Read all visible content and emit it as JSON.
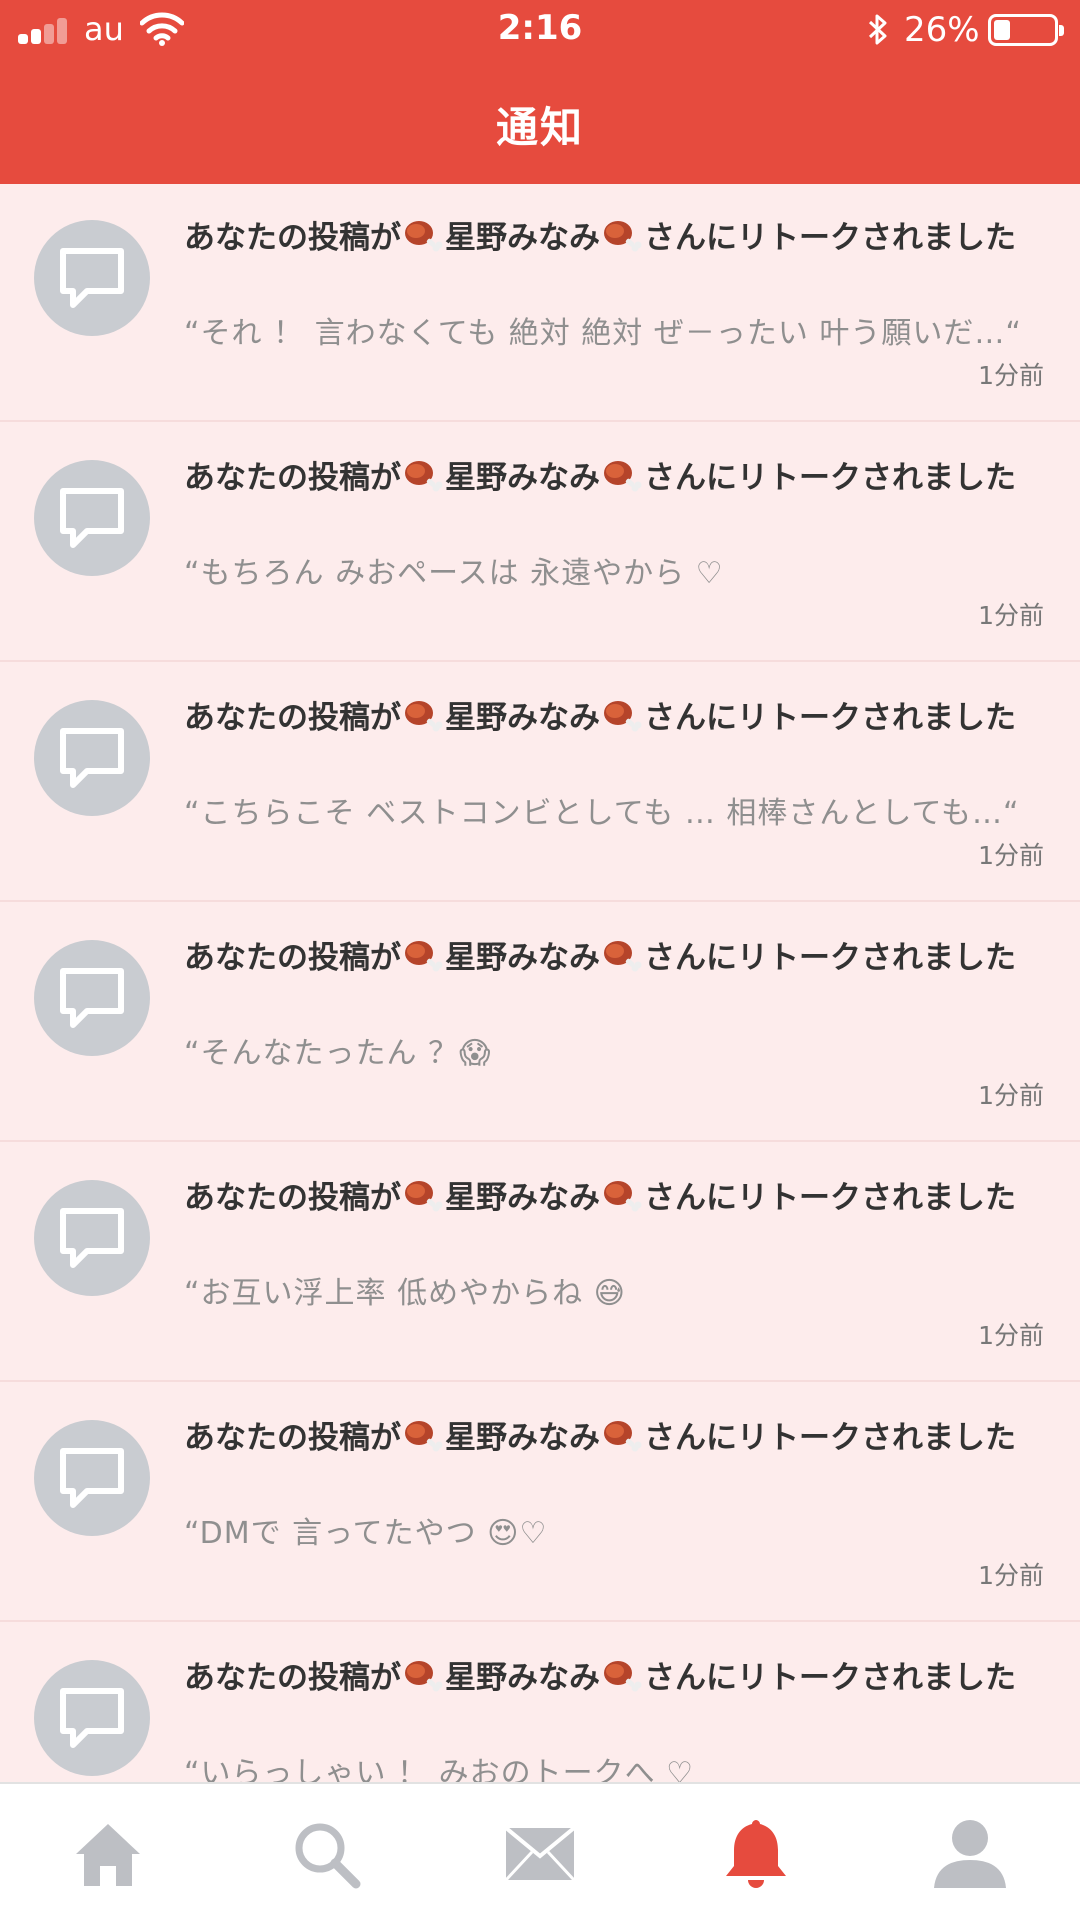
{
  "status_bar": {
    "carrier": "au",
    "time": "2:16",
    "battery": "26%"
  },
  "header": {
    "title": "通知"
  },
  "notifications": [
    {
      "headline_prefix": "あなたの投稿が",
      "headline_name": "星野みなみ",
      "headline_suffix": "さんにリトークされました",
      "icon": "meat-on-bone-icon",
      "preview": "“それ ！ 言わなくても 絶対 絶対 ぜ－ったい 叶う願いだ…“",
      "time": "1分前"
    },
    {
      "headline_prefix": "あなたの投稿が",
      "headline_name": "星野みなみ",
      "headline_suffix": "さんにリトークされました",
      "icon": "meat-on-bone-icon",
      "preview": "“もちろん みおペースは 永遠やから ♡",
      "time": "1分前"
    },
    {
      "headline_prefix": "あなたの投稿が",
      "headline_name": "星野みなみ",
      "headline_suffix": "さんにリトークされました",
      "icon": "meat-on-bone-icon",
      "preview": "“こちらこそ ベストコンビとしても … 相棒さんとしても…“",
      "time": "1分前"
    },
    {
      "headline_prefix": "あなたの投稿が",
      "headline_name": "星野みなみ",
      "headline_suffix": "さんにリトークされました",
      "icon": "meat-on-bone-icon",
      "preview": "“そんなたったん ？😱",
      "time": "1分前"
    },
    {
      "headline_prefix": "あなたの投稿が",
      "headline_name": "星野みなみ",
      "headline_suffix": "さんにリトークされました",
      "icon": "meat-on-bone-icon",
      "preview": "“お互い浮上率 低めやからね 😅",
      "time": "1分前"
    },
    {
      "headline_prefix": "あなたの投稿が",
      "headline_name": "星野みなみ",
      "headline_suffix": "さんにリトークされました",
      "icon": "meat-on-bone-icon",
      "preview": "“DMで 言ってたやつ 😍♡",
      "time": "1分前"
    },
    {
      "headline_prefix": "あなたの投稿が",
      "headline_name": "星野みなみ",
      "headline_suffix": "さんにリトークされました",
      "icon": "meat-on-bone-icon",
      "preview": "“いらっしゃい ！ みおのトークへ ♡",
      "time": ""
    }
  ],
  "tabs": [
    {
      "name": "home",
      "icon": "home-icon",
      "active": false
    },
    {
      "name": "search",
      "icon": "search-icon",
      "active": false
    },
    {
      "name": "messages",
      "icon": "mail-icon",
      "active": false
    },
    {
      "name": "notifications",
      "icon": "bell-icon",
      "active": true
    },
    {
      "name": "profile",
      "icon": "person-icon",
      "active": false
    }
  ],
  "colors": {
    "header": "#e64b3e",
    "list_bg": "#fdecec",
    "tab_active": "#e64b3e",
    "tab_inactive": "#bdbfc4",
    "avatar": "#c9ccd1"
  }
}
